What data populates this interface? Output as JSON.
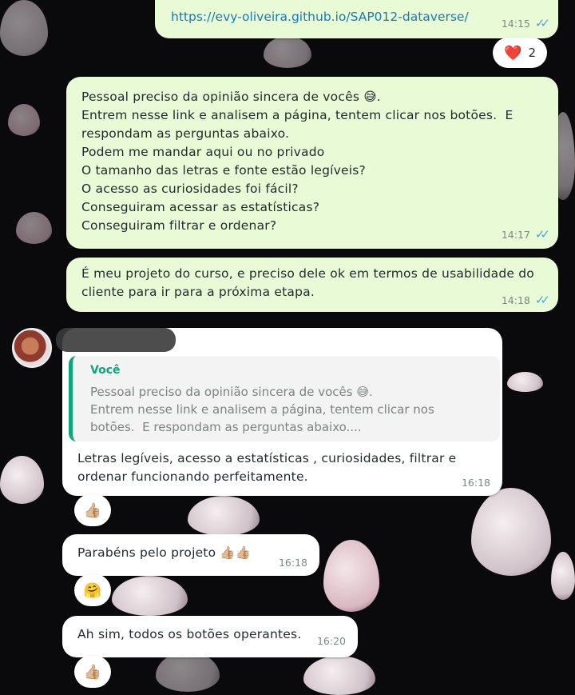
{
  "messages": [
    {
      "link": "https://evy-oliveira.github.io/SAP012-dataverse/",
      "time": "14:15",
      "ticks": "✓✓",
      "reaction": {
        "emoji": "❤️",
        "count": "2"
      }
    },
    {
      "text": "Pessoal preciso da opinião sincera de vocês 😅.\nEntrem nesse link e analisem a página, tentem clicar nos botões.  E\nrespondam as perguntas abaixo.\nPodem me mandar aqui ou no privado\nO tamanho das letras e fonte estão legíveis?\nO acesso as curiosidades foi fácil?\nConseguiram acessar as estatísticas?\nConseguiram filtrar e ordenar?",
      "time": "14:17",
      "ticks": "✓✓"
    },
    {
      "text": "É meu projeto do curso, e preciso dele ok em termos de usabilidade do\ncliente para ir para a próxima etapa.",
      "time": "14:18",
      "ticks": "✓✓"
    },
    {
      "quote": {
        "author": "Você",
        "text": "Pessoal preciso da opinião sincera de vocês 😅.\nEntrem nesse link e analisem a página, tentem clicar nos\nbotões.  E respondam as perguntas abaixo...."
      },
      "text": "Letras legíveis, acesso a estatísticas , curiosidades, filtrar e\nordenar funcionando perfeitamente.",
      "time": "16:18",
      "reaction": {
        "emoji": "👍🏼"
      }
    },
    {
      "text": "Parabéns pelo projeto 👍🏼👍🏼",
      "time": "16:18",
      "reaction": {
        "emoji": "🤗"
      }
    },
    {
      "text": "Ah sim, todos os botões operantes.",
      "time": "16:20",
      "reaction": {
        "emoji": "👍🏼"
      }
    }
  ],
  "colors": {
    "outgoing": "#e8fbd6",
    "incoming": "#ffffff",
    "ticks": "#4aa3e8",
    "quote_accent": "#0da57a"
  },
  "icons": {
    "ticks": "double-check-icon",
    "avatar": "contact-avatar"
  }
}
